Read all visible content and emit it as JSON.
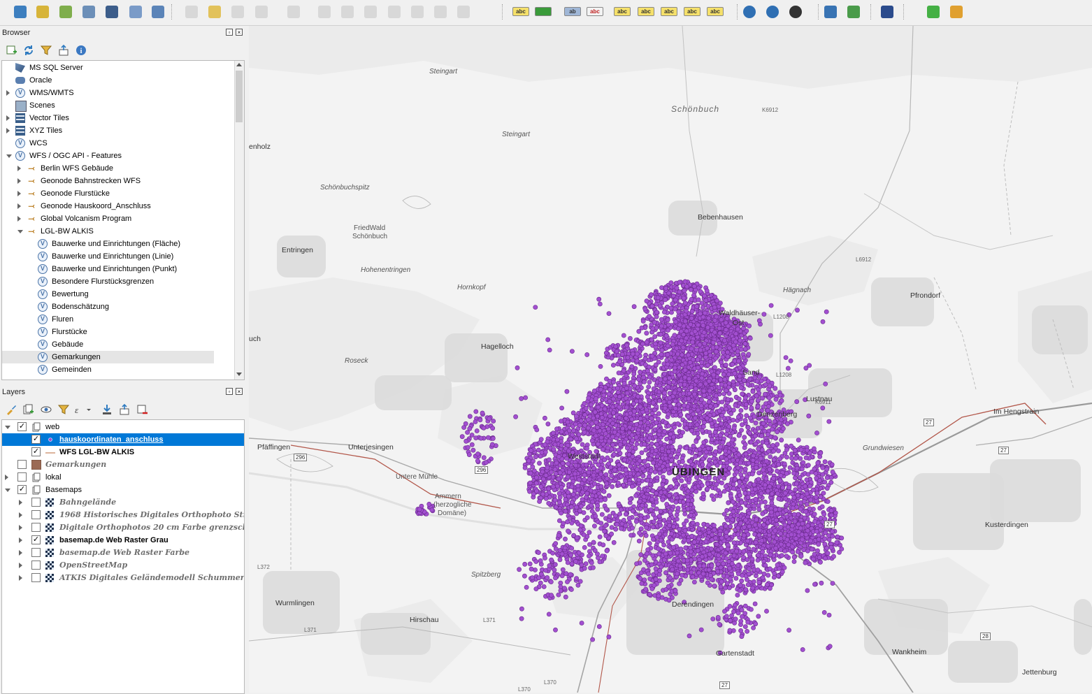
{
  "toolbar": {
    "buttons": [
      {
        "name": "open-data-source-manager-icon",
        "color": "#3d7fbf"
      },
      {
        "name": "new-geopackage-layer-icon",
        "color": "#d7b43a"
      },
      {
        "name": "new-shapefile-layer-icon",
        "color": "#7fae4c"
      },
      {
        "name": "new-temporary-scratch-layer-icon",
        "color": "#6c8fb8"
      },
      {
        "name": "new-virtual-layer-icon",
        "color": "#3c5d8a"
      },
      {
        "name": "add-raster-layer-icon",
        "color": "#7a9bc8"
      },
      {
        "name": "add-wfs-layer-icon",
        "color": "#5b84b8"
      },
      {
        "name": "current-edits-icon",
        "color": "#c8c8c8"
      },
      {
        "name": "toggle-editing-icon",
        "color": "#e2c25b"
      },
      {
        "name": "save-layer-edits-icon",
        "color": "#c8c8c8"
      },
      {
        "name": "digitize-line-icon",
        "color": "#c8c8c8"
      },
      {
        "name": "vertex-tool-icon",
        "color": "#c8c8c8"
      },
      {
        "name": "modify-attributes-icon",
        "color": "#c8c8c8"
      },
      {
        "name": "delete-selected-icon",
        "color": "#c8c8c8"
      },
      {
        "name": "cut-features-icon",
        "color": "#c8c8c8"
      },
      {
        "name": "copy-features-icon",
        "color": "#c8c8c8"
      },
      {
        "name": "paste-features-icon",
        "color": "#c8c8c8"
      },
      {
        "name": "undo-icon",
        "color": "#c8c8c8"
      },
      {
        "name": "redo-icon",
        "color": "#c8c8c8"
      }
    ],
    "label_buttons": [
      {
        "name": "layer-labeling-options-icon",
        "text": "abc",
        "bg": "#f5e06a",
        "fg": "#333333"
      },
      {
        "name": "layer-diagram-options-icon",
        "text": "",
        "bg": "#3a9b3a",
        "fg": "#333333"
      },
      {
        "name": "pin-labels-icon",
        "text": "ab",
        "bg": "#9fb6d6",
        "fg": "#333333"
      },
      {
        "name": "highlight-pinned-labels-icon",
        "text": "abc",
        "bg": "#f3f3f3",
        "fg": "#c02020"
      },
      {
        "name": "pin-unpin-labels-icon",
        "text": "abc",
        "bg": "#f5e06a",
        "fg": "#333333"
      },
      {
        "name": "show-hide-labels-icon",
        "text": "abc",
        "bg": "#f5e06a",
        "fg": "#333333"
      },
      {
        "name": "move-label-icon",
        "text": "abc",
        "bg": "#f5e06a",
        "fg": "#333333"
      },
      {
        "name": "rotate-label-icon",
        "text": "abc",
        "bg": "#f5e06a",
        "fg": "#333333"
      },
      {
        "name": "change-label-icon",
        "text": "abc",
        "bg": "#f5e06a",
        "fg": "#333333"
      }
    ],
    "right_buttons": [
      {
        "name": "metasearch-icon",
        "color": "#2f6fb3"
      },
      {
        "name": "metasearch-search-icon",
        "color": "#2f6fb3"
      },
      {
        "name": "quickmapservices-icon",
        "color": "#333333"
      },
      {
        "name": "python-console-icon",
        "color": "#3873b3"
      },
      {
        "name": "plugin-layers-icon",
        "color": "#4a9b4a"
      },
      {
        "name": "help-icon",
        "color": "#2b4b8c"
      },
      {
        "name": "zoom-tool-icon",
        "color": "#45b045"
      },
      {
        "name": "measure-icon",
        "color": "#e0a030"
      }
    ]
  },
  "browser": {
    "title": "Browser",
    "items": [
      {
        "label": "MS SQL Server",
        "indent": 0,
        "expander": "none",
        "icon": "mssql-icon"
      },
      {
        "label": "Oracle",
        "indent": 0,
        "expander": "none",
        "icon": "oracle-icon"
      },
      {
        "label": "WMS/WMTS",
        "indent": 0,
        "expander": "closed",
        "icon": "wms-icon"
      },
      {
        "label": "Scenes",
        "indent": 0,
        "expander": "none",
        "icon": "scenes-icon"
      },
      {
        "label": "Vector Tiles",
        "indent": 0,
        "expander": "closed",
        "icon": "vector-tiles-icon"
      },
      {
        "label": "XYZ Tiles",
        "indent": 0,
        "expander": "closed",
        "icon": "xyz-tiles-icon"
      },
      {
        "label": "WCS",
        "indent": 0,
        "expander": "none",
        "icon": "wcs-icon"
      },
      {
        "label": "WFS / OGC API - Features",
        "indent": 0,
        "expander": "open",
        "icon": "wfs-icon"
      },
      {
        "label": "Berlin WFS Gebäude",
        "indent": 1,
        "expander": "closed",
        "icon": "wfs-connection-icon"
      },
      {
        "label": "Geonode Bahnstrecken WFS",
        "indent": 1,
        "expander": "closed",
        "icon": "wfs-connection-icon"
      },
      {
        "label": "Geonode Flurstücke",
        "indent": 1,
        "expander": "closed",
        "icon": "wfs-connection-icon"
      },
      {
        "label": "Geonode Hauskoord_Anschluss",
        "indent": 1,
        "expander": "closed",
        "icon": "wfs-connection-icon"
      },
      {
        "label": "Global Volcanism Program",
        "indent": 1,
        "expander": "closed",
        "icon": "wfs-connection-icon"
      },
      {
        "label": "LGL-BW ALKIS",
        "indent": 1,
        "expander": "open",
        "icon": "wfs-connection-icon"
      },
      {
        "label": "Bauwerke und Einrichtungen (Fläche)",
        "indent": 2,
        "expander": "none",
        "icon": "wfs-layer-icon"
      },
      {
        "label": "Bauwerke und Einrichtungen (Linie)",
        "indent": 2,
        "expander": "none",
        "icon": "wfs-layer-icon"
      },
      {
        "label": "Bauwerke und Einrichtungen (Punkt)",
        "indent": 2,
        "expander": "none",
        "icon": "wfs-layer-icon"
      },
      {
        "label": "Besondere Flurstücksgrenzen",
        "indent": 2,
        "expander": "none",
        "icon": "wfs-layer-icon"
      },
      {
        "label": "Bewertung",
        "indent": 2,
        "expander": "none",
        "icon": "wfs-layer-icon"
      },
      {
        "label": "Bodenschätzung",
        "indent": 2,
        "expander": "none",
        "icon": "wfs-layer-icon"
      },
      {
        "label": "Fluren",
        "indent": 2,
        "expander": "none",
        "icon": "wfs-layer-icon"
      },
      {
        "label": "Flurstücke",
        "indent": 2,
        "expander": "none",
        "icon": "wfs-layer-icon"
      },
      {
        "label": "Gebäude",
        "indent": 2,
        "expander": "none",
        "icon": "wfs-layer-icon"
      },
      {
        "label": "Gemarkungen",
        "indent": 2,
        "expander": "none",
        "icon": "wfs-layer-icon",
        "highlighted": true
      },
      {
        "label": "Gemeinden",
        "indent": 2,
        "expander": "none",
        "icon": "wfs-layer-icon"
      }
    ]
  },
  "layers": {
    "title": "Layers",
    "items": [
      {
        "label": "web",
        "level": 0,
        "expander": "open",
        "checked": true,
        "type": "group",
        "style": "normal"
      },
      {
        "label": "hauskoordinaten_anschluss",
        "level": 1,
        "expander": "none",
        "checked": true,
        "type": "point",
        "style": "selected"
      },
      {
        "label": "WFS LGL-BW ALKIS",
        "level": 1,
        "expander": "none",
        "checked": true,
        "type": "line",
        "style": "bold"
      },
      {
        "label": "Gemarkungen",
        "level": 0,
        "expander": "none",
        "checked": false,
        "type": "polygon",
        "style": "off"
      },
      {
        "label": "lokal",
        "level": 0,
        "expander": "closed",
        "checked": false,
        "type": "group",
        "style": "normal"
      },
      {
        "label": "Basemaps",
        "level": 0,
        "expander": "open",
        "checked": true,
        "type": "group",
        "style": "normal"
      },
      {
        "label": "Bahngelände",
        "level": 1,
        "expander": "closed",
        "checked": false,
        "type": "raster",
        "style": "off"
      },
      {
        "label": "1968 Historisches Digitales Orthophoto Straße",
        "level": 1,
        "expander": "closed",
        "checked": false,
        "type": "raster",
        "style": "off"
      },
      {
        "label": "Digitale Orthophotos 20 cm Farbe grenzscharf",
        "level": 1,
        "expander": "closed",
        "checked": false,
        "type": "raster",
        "style": "off"
      },
      {
        "label": "basemap.de Web Raster Grau",
        "level": 1,
        "expander": "closed",
        "checked": true,
        "type": "raster",
        "style": "bold"
      },
      {
        "label": "basemap.de Web Raster Farbe",
        "level": 1,
        "expander": "closed",
        "checked": false,
        "type": "raster",
        "style": "off"
      },
      {
        "label": "OpenStreetMap",
        "level": 1,
        "expander": "closed",
        "checked": false,
        "type": "raster",
        "style": "off"
      },
      {
        "label": "ATKIS Digitales Geländemodell Schummerung",
        "level": 1,
        "expander": "closed",
        "checked": false,
        "type": "raster",
        "style": "off"
      }
    ]
  },
  "map": {
    "point_color": "#a24fd0",
    "point_stroke": "#6a2a8c",
    "selection_color": "#0078d7",
    "labels": [
      {
        "text": "Steingart",
        "style": "it"
      },
      {
        "text": "Schönbuch",
        "style": "lg"
      },
      {
        "text": "Steingart",
        "style": "it"
      },
      {
        "text": "enholz",
        "style": "town"
      },
      {
        "text": "Schönbuchspitz",
        "style": "it"
      },
      {
        "text": "FriedWald",
        "style": "normal"
      },
      {
        "text": "Schönbuch",
        "style": "normal"
      },
      {
        "text": "Bebenhausen",
        "style": "town"
      },
      {
        "text": "Entringen",
        "style": "town"
      },
      {
        "text": "Hohenentringen",
        "style": "it"
      },
      {
        "text": "Hornkopf",
        "style": "it"
      },
      {
        "text": "Hägnach",
        "style": "it"
      },
      {
        "text": "Pfrondorf",
        "style": "town"
      },
      {
        "text": "Waldhäuser-",
        "style": "town"
      },
      {
        "text": "Ost",
        "style": "town"
      },
      {
        "text": "Hagelloch",
        "style": "town"
      },
      {
        "text": "Roseck",
        "style": "it"
      },
      {
        "text": "uch",
        "style": "town"
      },
      {
        "text": "Sand",
        "style": "town"
      },
      {
        "text": "Lustnau",
        "style": "town"
      },
      {
        "text": "Denzenberg",
        "style": "town"
      },
      {
        "text": "Im Hengstrain",
        "style": "town"
      },
      {
        "text": "Pfäffingen",
        "style": "town"
      },
      {
        "text": "Unterjesingen",
        "style": "town"
      },
      {
        "text": "Grundwiesen",
        "style": "it"
      },
      {
        "text": "Untere Mühle",
        "style": "normal"
      },
      {
        "text": "Ammern",
        "style": "normal"
      },
      {
        "text": "(herzogliche",
        "style": "normal"
      },
      {
        "text": "Domäne)",
        "style": "normal"
      },
      {
        "text": "Weststadt",
        "style": "town"
      },
      {
        "text": "ÜBINGEN",
        "style": "big"
      },
      {
        "text": "Kusterdingen",
        "style": "town"
      },
      {
        "text": "Spitzberg",
        "style": "it"
      },
      {
        "text": "Wurmlingen",
        "style": "town"
      },
      {
        "text": "Hirschau",
        "style": "town"
      },
      {
        "text": "Derendingen",
        "style": "town"
      },
      {
        "text": "Gartenstadt",
        "style": "town"
      },
      {
        "text": "Wankheim",
        "style": "town"
      },
      {
        "text": "Jettenburg",
        "style": "town"
      }
    ],
    "road_numbers": [
      "296",
      "296",
      "27",
      "27",
      "27",
      "28",
      "27",
      "L371",
      "L370",
      "L370",
      "L372",
      "L1208",
      "L1208",
      "K6912",
      "L6912",
      "K6911",
      "L371"
    ]
  }
}
